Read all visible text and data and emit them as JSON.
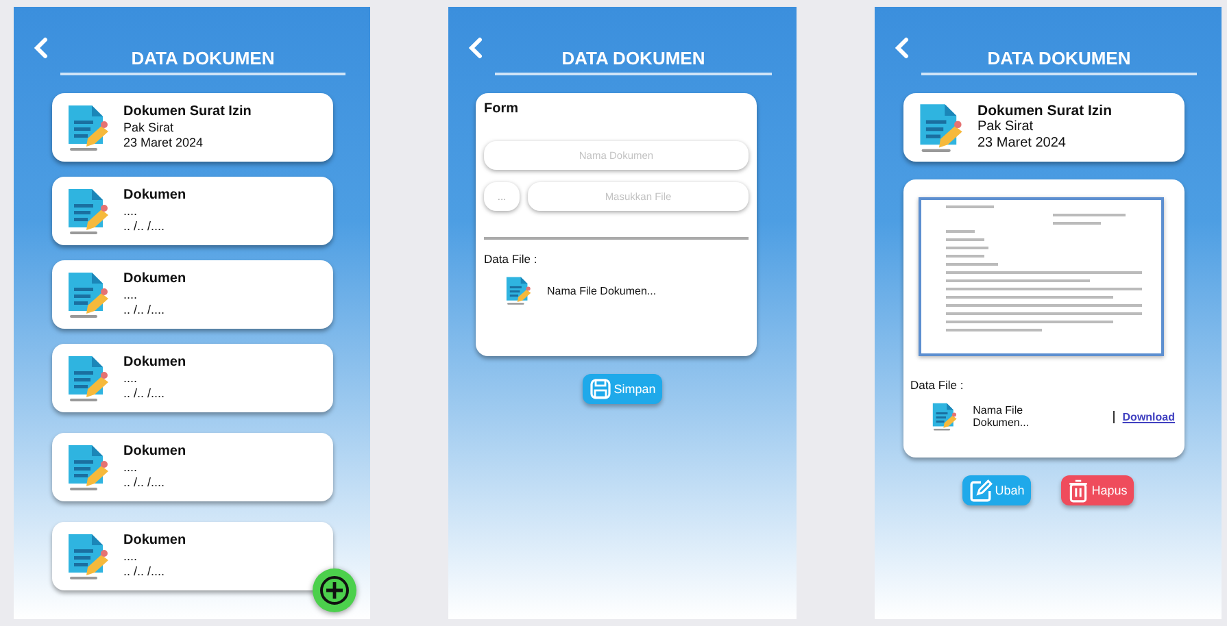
{
  "screens": [
    {
      "kind": "list",
      "title": "DATA DOKUMEN",
      "documents": [
        {
          "title": "Dokumen Surat Izin",
          "owner": "Pak Sirat",
          "date": "23 Maret 2024"
        },
        {
          "title": "Dokumen",
          "owner": "....",
          "date": ".. /.. /...."
        },
        {
          "title": "Dokumen",
          "owner": "....",
          "date": ".. /.. /...."
        },
        {
          "title": "Dokumen",
          "owner": "....",
          "date": ".. /.. /...."
        },
        {
          "title": "Dokumen",
          "owner": "....",
          "date": ".. /.. /...."
        },
        {
          "title": "Dokumen",
          "owner": "....",
          "date": ".. /.. /...."
        }
      ]
    },
    {
      "kind": "form",
      "title": "DATA DOKUMEN",
      "form": {
        "heading": "Form",
        "name_field": {
          "placeholder": "Nama Dokumen"
        },
        "browse_button": "...",
        "file_field": {
          "placeholder": "Masukkan File"
        },
        "file_label": "Data File :",
        "file_name": "Nama File Dokumen..."
      },
      "buttons": [
        {
          "kind": "save",
          "label": "Simpan"
        }
      ]
    },
    {
      "kind": "detail",
      "title": "DATA DOKUMEN",
      "document": {
        "title": "Dokumen Surat Izin",
        "owner": "Pak Sirat",
        "date": "23 Maret 2024"
      },
      "file_label": "Data File :",
      "file_name": "Nama File Dokumen...",
      "link": "Download",
      "buttons": [
        {
          "kind": "edit",
          "label": "Ubah"
        },
        {
          "kind": "delete",
          "label": "Hapus"
        }
      ]
    }
  ]
}
